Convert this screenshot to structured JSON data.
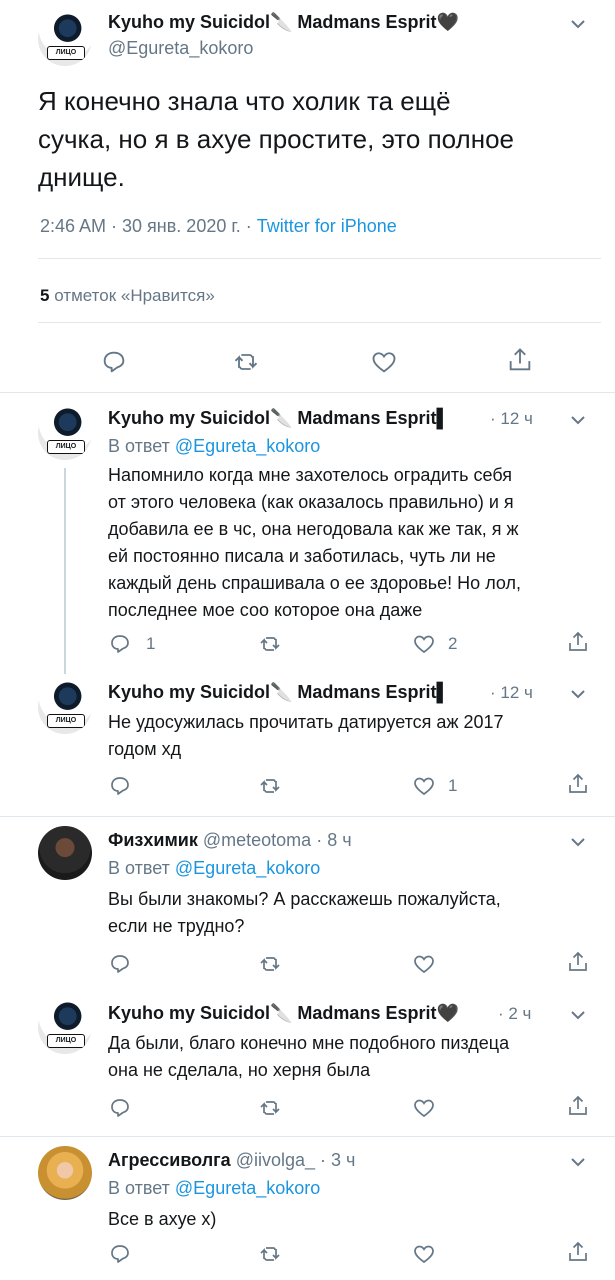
{
  "main_tweet": {
    "name": "Kyuho my Suicidol🔪 Madmans Esprit🖤",
    "handle": "@Egureta_kokoro",
    "text_lines": [
      "Я конечно знала что холик та ещё",
      "сучка, но я в ахуе простите, это полное",
      "днище."
    ],
    "time": "2:46 AM · 30 янв. 2020 г. ·",
    "source": "Twitter for iPhone",
    "likes_count": "5",
    "likes_label": "отметок «Нравится»",
    "badge": "ЛИЦО"
  },
  "replies": [
    {
      "name": "Kyuho my Suicidol🔪 Madmans Esprit▌",
      "meta": "· 12 ч",
      "reply_prefix": "В ответ",
      "reply_to": "@Egureta_kokoro",
      "lines": [
        "Напомнило когда мне захотелось оградить себя",
        "от этого человека (как оказалось правильно) и я",
        "добавила ее в чс, она негодовала как же так, я ж",
        "ей постоянно писала и заботилась, чуть ли не",
        "каждый день спрашивала о ее здоровье! Но лол,",
        "последнее мое соо которое она даже"
      ],
      "reply_count": "1",
      "like_count": "2",
      "badge": "ЛИЦО"
    },
    {
      "name": "Kyuho my Suicidol🔪 Madmans Esprit▌",
      "meta": "· 12 ч",
      "lines": [
        "Не удосужилась прочитать датируется аж 2017",
        "годом хд"
      ],
      "like_count": "1",
      "badge": "ЛИЦО"
    },
    {
      "name": "Физхимик",
      "handle": "@meteotoma",
      "meta": "· 8 ч",
      "reply_prefix": "В ответ",
      "reply_to": "@Egureta_kokoro",
      "lines": [
        "Вы были знакомы? А расскажешь пожалуйста,",
        "если не трудно?"
      ]
    },
    {
      "name": "Kyuho my Suicidol🔪 Madmans Esprit🖤",
      "meta": "· 2 ч",
      "lines": [
        "Да были, благо конечно мне подобного пиздеца",
        "она не сделала, но херня была"
      ],
      "badge": "ЛИЦО"
    },
    {
      "name": "Агрессиволга",
      "handle": "@iivolga_",
      "meta": "· 3 ч",
      "reply_prefix": "В ответ",
      "reply_to": "@Egureta_kokoro",
      "lines": [
        "Все в ахуе х)"
      ]
    }
  ]
}
